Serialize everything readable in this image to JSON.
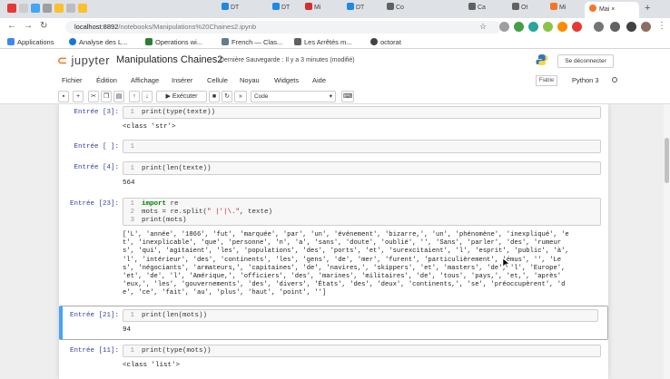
{
  "browser": {
    "tabs": [
      {
        "label": "DT",
        "color": "#1e88e5"
      },
      {
        "label": "DT",
        "color": "#1e88e5"
      },
      {
        "label": "Mi",
        "color": "#d32f2f"
      },
      {
        "label": "DT",
        "color": "#1e88e5"
      },
      {
        "label": "Co",
        "color": "#616161"
      },
      {
        "label": "Ca",
        "color": "#616161"
      },
      {
        "label": "Ot",
        "color": "#616161"
      },
      {
        "label": "Mi",
        "color": "#f37726"
      }
    ],
    "active_tab": "Mai",
    "url_host": "localhost:8892",
    "url_path": "/notebooks/Manipulations%20Chaines2.ipynb",
    "bookmarks": [
      {
        "label": "Applications",
        "color": "#4285f4"
      },
      {
        "label": "Analyse des L...",
        "color": "#1976d2"
      },
      {
        "label": "Operations wi...",
        "color": "#2e7d32"
      },
      {
        "label": "French — Clas...",
        "color": "#607d8b"
      },
      {
        "label": "Les Arrêtés m...",
        "color": "#616161"
      },
      {
        "label": "octorat",
        "color": "#424242"
      }
    ]
  },
  "jupyter": {
    "logo": "jupyter",
    "notebook_title": "Manipulations Chaines2",
    "save_status": "Dernière Sauvegarde : Il y a 3 minutes",
    "save_modified": "(modifié)",
    "logout_label": "Se déconnecter",
    "menus": [
      "Fichier",
      "Édition",
      "Affichage",
      "Insérer",
      "Cellule",
      "Noyau",
      "Widgets",
      "Aide"
    ],
    "trusted_label": "Fiable",
    "kernel_name": "Python 3",
    "toolbar": {
      "run_label": "Exécuter",
      "cell_type": "Code"
    }
  },
  "cells": [
    {
      "prompt": "Entrée [3]:",
      "lines": [
        {
          "n": "1",
          "code": "print(type(texte))"
        }
      ],
      "output": "<class 'str'>"
    },
    {
      "prompt": "Entrée [ ]:",
      "lines": [
        {
          "n": "1",
          "code": ""
        }
      ],
      "output": ""
    },
    {
      "prompt": "Entrée [4]:",
      "lines": [
        {
          "n": "1",
          "code": "print(len(texte))"
        }
      ],
      "output": "564"
    },
    {
      "prompt": "Entrée [23]:",
      "lines": [
        {
          "n": "1",
          "kw": "import",
          "code": " re"
        },
        {
          "n": "2",
          "code": "mots = re.split(",
          "str": "\" |'|\\.\"",
          "code2": ", texte)"
        },
        {
          "n": "3",
          "code": "print(mots)"
        }
      ],
      "output_lines": [
        "['L', 'année', '1866', 'fut', 'marquée', 'par', 'un', 'événement', 'bizarre,', 'un', 'phénomène', 'inexpliqué', 'e",
        "t', 'inexplicable', 'que', 'personne', 'n', 'a', 'sans', 'doute', 'oublié', '', 'Sans', 'parler', 'des', 'rumeur",
        "s', 'qui', 'agitaient', 'les', 'populations', 'des', 'ports', 'et', 'surexcitaient', 'l', 'esprit', 'public', 'à',",
        "'l', 'intérieur', 'des', 'continents', 'les', 'gens', 'de', 'mer', 'furent', 'particulièrement', 'émus', '', 'Le",
        "s', 'négociants', 'armateurs,', 'capitaines', 'de', 'navires,', 'skippers', 'et', 'masters', 'de', 'l', 'Europe',",
        "'et', 'de', 'l', 'Amérique,', 'officiers', 'des', 'marines', 'militaires', 'de', 'tous', 'pays,', 'et,', 'après'",
        "'eux,', 'les', 'gouvernements', 'des', 'divers', 'États', 'des', 'deux', 'continents,', 'se', 'préoccupèrent', 'd",
        "e', 'ce', 'fait', 'au', 'plus', 'haut', 'point', '']"
      ]
    },
    {
      "prompt": "Entrée [21]:",
      "lines": [
        {
          "n": "1",
          "code": "print(len(mots))"
        }
      ],
      "output": "94"
    },
    {
      "prompt": "Entrée [11]:",
      "lines": [
        {
          "n": "1",
          "code": "print(type(mots))"
        }
      ],
      "output": "<class 'list'>"
    }
  ]
}
